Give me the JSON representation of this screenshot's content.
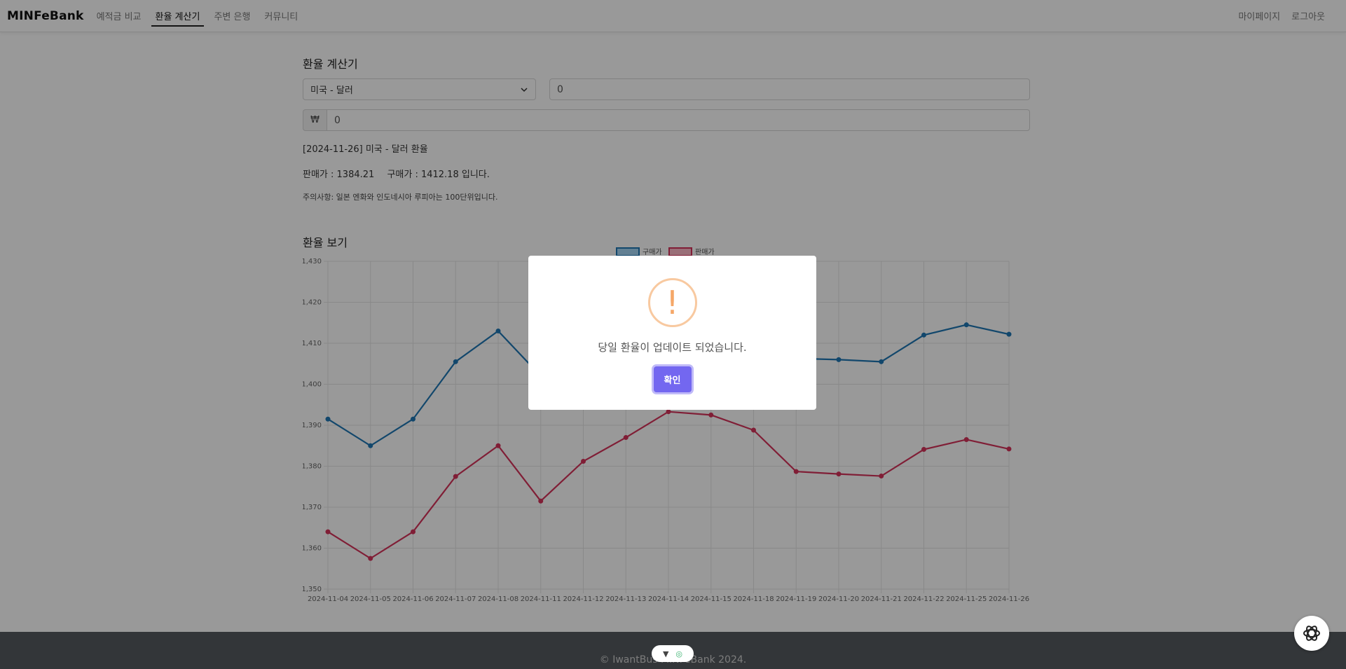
{
  "nav": {
    "brand": "MINFeBank",
    "items": [
      {
        "label": "예적금 비교"
      },
      {
        "label": "환율 계산기",
        "active": true
      },
      {
        "label": "주변 은행"
      },
      {
        "label": "커뮤니티"
      }
    ],
    "right": [
      {
        "label": "마이페이지"
      },
      {
        "label": "로그아웃"
      }
    ]
  },
  "calculator": {
    "title": "환율 계산기",
    "currency_selected": "미국 - 달러",
    "foreign_amount": "0",
    "won_symbol": "₩",
    "won_amount": "0",
    "rate_heading": "[2024-11-26] 미국 - 달러 환율",
    "sell_text": "판매가 : 1384.21",
    "buy_text": "구매가 : 1412.18 입니다.",
    "notice": "주의사항: 일본 엔화와 인도네시아 루피아는 100단위입니다."
  },
  "chart_section": {
    "title": "환율 보기"
  },
  "chart_data": {
    "type": "line",
    "categories": [
      "2024-11-04",
      "2024-11-05",
      "2024-11-06",
      "2024-11-07",
      "2024-11-08",
      "2024-11-11",
      "2024-11-12",
      "2024-11-13",
      "2024-11-14",
      "2024-11-15",
      "2024-11-18",
      "2024-11-19",
      "2024-11-20",
      "2024-11-21",
      "2024-11-22",
      "2024-11-25",
      "2024-11-26"
    ],
    "series": [
      {
        "name": "구매가",
        "color": "#36a2eb",
        "values": [
          1391.5,
          1385.0,
          1391.5,
          1405.5,
          1413.0,
          1402.0,
          1404.0,
          1406.0,
          1408.0,
          1407.5,
          1406.5,
          1406.3,
          1406.0,
          1405.5,
          1412.0,
          1414.5,
          1412.2
        ]
      },
      {
        "name": "판매가",
        "color": "#ff6384",
        "values": [
          1364.0,
          1357.5,
          1364.0,
          1377.5,
          1385.0,
          1371.5,
          1381.2,
          1387.0,
          1393.3,
          1392.5,
          1388.8,
          1378.7,
          1378.1,
          1377.6,
          1384.1,
          1386.5,
          1384.2
        ]
      }
    ],
    "ylim": [
      1350,
      1430
    ],
    "yticks": [
      "1,350",
      "1,360",
      "1,370",
      "1,380",
      "1,390",
      "1,400",
      "1,410",
      "1,420",
      "1,430"
    ],
    "grid": true,
    "legend_position": "top"
  },
  "footer": {
    "copyright": "© IwantBus MINFeBank 2024."
  },
  "modal": {
    "icon": "warning-icon",
    "icon_glyph": "!",
    "message": "당일 환율이 업데이트 되었습니다.",
    "confirm_label": "확인",
    "accent": "#7367f0"
  }
}
